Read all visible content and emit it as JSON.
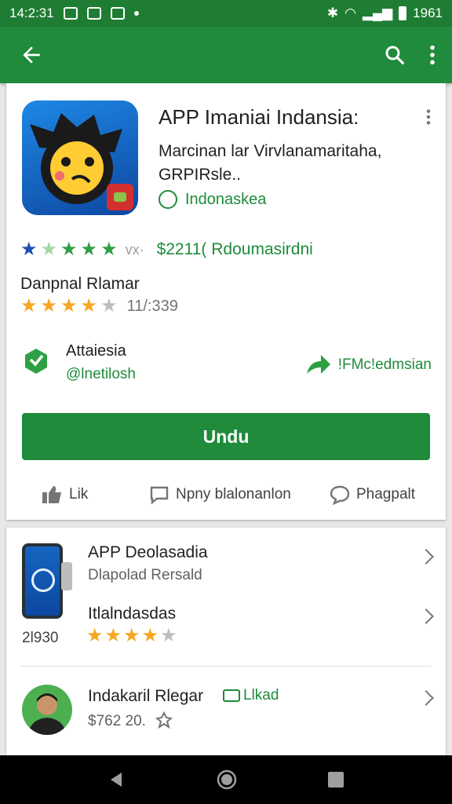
{
  "status": {
    "time": "14:2:31",
    "battery": "1961"
  },
  "app": {
    "title": "APP Imaniai Indansia:",
    "developer": "Marcinan lar Virvlanamaritaha, GRPIRsle..",
    "verified": "Indonaskea"
  },
  "rating": {
    "price": "$2211( Rdoumasirdni",
    "sep": "vx·"
  },
  "sub": {
    "label": "Danpnal Rlamar",
    "count": "11/:339"
  },
  "dev": {
    "name": "Attaiesia",
    "handle": "@lnetilosh",
    "share": "!FMc!edmsian"
  },
  "install_label": "Undu",
  "actions": {
    "like": "Lik",
    "comment": "Npny blalonanlon",
    "share": "Phagpalt"
  },
  "related": {
    "items": [
      {
        "title": "APP Deolasadia",
        "sub": "Dlapolad Rersald"
      },
      {
        "title": "Itlalndasdas",
        "sub": "2l930"
      },
      {
        "title": "Indakaril Rlegar",
        "tag": "Llkad",
        "sub": "$762 20."
      }
    ]
  },
  "colors": {
    "primary": "#1f8b3b",
    "star_green": "#2ea043",
    "star_gold": "#f5a623"
  }
}
